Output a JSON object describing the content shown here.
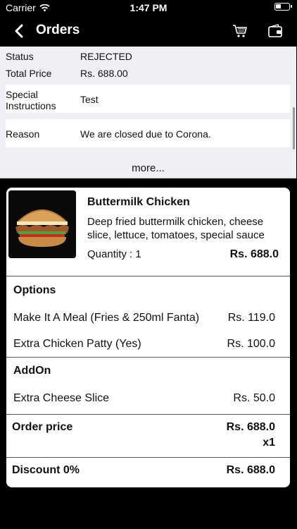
{
  "status_bar": {
    "carrier": "Carrier",
    "time": "1:47 PM"
  },
  "nav": {
    "title": "Orders",
    "back_icon": "chevron-left-icon",
    "cart_icon": "cart-icon",
    "wallet_icon": "wallet-icon"
  },
  "order_info": {
    "status_label": "Status",
    "status_value": "REJECTED",
    "total_label": "Total Price",
    "total_value": "Rs. 688.00",
    "instructions_label": "Special Instructions",
    "instructions_value": "Test",
    "reason_label": "Reason",
    "reason_value": "We are closed due to Corona.",
    "more_label": "more..."
  },
  "item": {
    "name": "Buttermilk Chicken",
    "description": "Deep fried buttermilk chicken, cheese slice, lettuce, tomatoes, special sauce",
    "quantity": "Quantity : 1",
    "price": "Rs. 688.0"
  },
  "options": {
    "heading": "Options",
    "lines": [
      {
        "label": "Make It A Meal  (Fries & 250ml Fanta)",
        "price": "Rs. 119.0"
      },
      {
        "label": "Extra Chicken Patty  (Yes)",
        "price": "Rs. 100.0"
      }
    ]
  },
  "addon": {
    "heading": "AddOn",
    "lines": [
      {
        "label": "Extra Cheese Slice",
        "price": "Rs. 50.0"
      }
    ]
  },
  "summary": {
    "order_price_label": "Order price",
    "order_price_value": "Rs. 688.0",
    "order_multiplier": "x1",
    "discount_label": "Discount 0%",
    "discount_value": "Rs. 688.0"
  }
}
